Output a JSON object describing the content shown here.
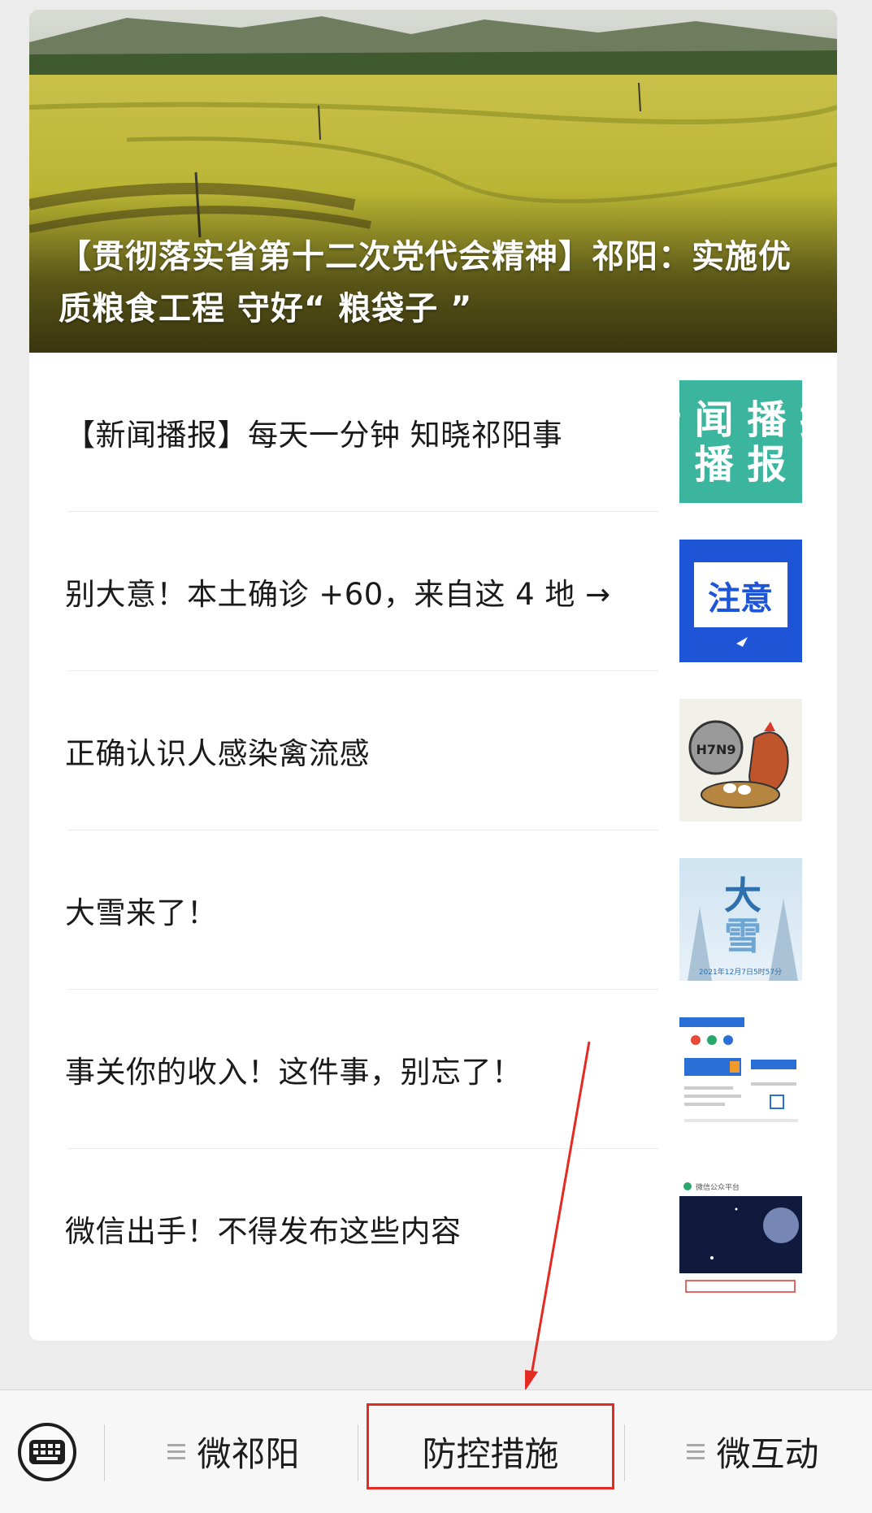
{
  "hero": {
    "title": "【贯彻落实省第十二次党代会精神】祁阳：实施优质粮食工程  守好“ 粮袋子 ”"
  },
  "articles": [
    {
      "title": "【新闻播报】每天一分钟 知晓祁阳事",
      "thumb_text": "新 闻 播 报"
    },
    {
      "title": "别大意！本土确诊 +60，来自这 4 地 →",
      "thumb_text": "注意"
    },
    {
      "title": "正确认识人感染禽流感",
      "thumb_text": "H7N9"
    },
    {
      "title": "大雪来了！",
      "thumb_text": "大 雪",
      "thumb_caption": "2021年12月7日5时57分"
    },
    {
      "title": "事关你的收入！这件事，别忘了！"
    },
    {
      "title": "微信出手！不得发布这些内容",
      "thumb_header": "微信公众平台"
    }
  ],
  "menu": {
    "items": [
      {
        "label": "微祁阳"
      },
      {
        "label": "防控措施"
      },
      {
        "label": "微互动"
      }
    ]
  },
  "colors": {
    "accent_red": "#e52a22",
    "menu_bg": "#f7f7f7",
    "page_bg": "#ececec"
  },
  "icons": {
    "keyboard": "keyboard-icon",
    "menu": "hamburger-icon"
  }
}
